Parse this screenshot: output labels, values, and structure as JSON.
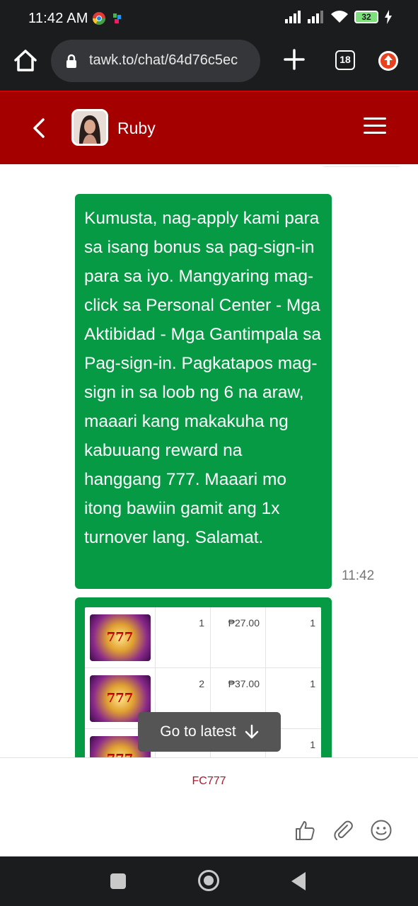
{
  "status_bar": {
    "time": "11:42 AM",
    "battery": "32",
    "icons": [
      "chrome-icon",
      "app-notification-icon",
      "signal-icon",
      "signal-icon",
      "wifi-icon",
      "battery-icon",
      "charging-icon"
    ]
  },
  "browser": {
    "url": "tawk.to/chat/64d76c5ec",
    "tab_count": "18"
  },
  "chat_header": {
    "agent_name": "Ruby"
  },
  "messages": [
    {
      "text": "Kumusta, nag-apply kami para sa isang bonus sa pag-sign-in para sa iyo. Mangyaring mag-click sa Personal Center - Mga Aktibidad - Mga Gantimpala sa Pag-sign-in. Pagkatapos mag-sign in sa loob ng 6 na araw, maaari kang makakuha ng kabuuang reward na hanggang 777. Maaari mo itong bawiin gamit ang 1x turnover lang. Salamat.",
      "time": "11:42"
    }
  ],
  "image_table": {
    "rows": [
      {
        "num": "1",
        "price": "₱27.00",
        "qty": "1"
      },
      {
        "num": "2",
        "price": "₱37.00",
        "qty": "1"
      },
      {
        "num": "",
        "price": "",
        "qty": "1"
      }
    ]
  },
  "go_to_latest": {
    "label": "Go to latest"
  },
  "footer": {
    "brand": "FC777"
  },
  "colors": {
    "header": "#a50000",
    "bubble": "#069a44",
    "brand_text": "#b0152a"
  }
}
